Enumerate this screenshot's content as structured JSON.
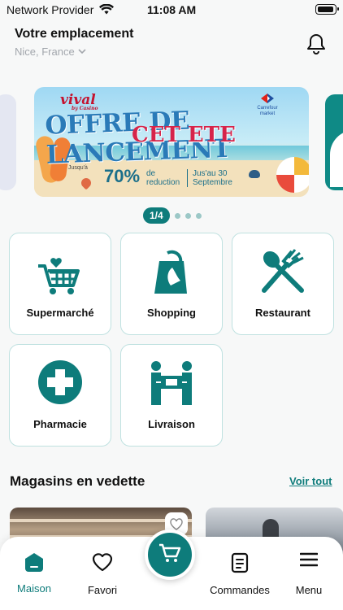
{
  "status_bar": {
    "carrier": "Network Provider",
    "time": "11:08 AM"
  },
  "header": {
    "title": "Votre emplacement",
    "location": "Nice, France"
  },
  "banner": {
    "brand_left": "vival",
    "brand_left_sub": "by Casino",
    "brand_right": "Carrefour market",
    "headline": "OFFRE DE LANCEMENT",
    "subheadline": "CET ETE",
    "promo_prefix": "Jusqu'à",
    "promo_value": "70%",
    "promo_word": "de reduction",
    "promo_date": "Jus'au 30 Septembre"
  },
  "pager": {
    "label": "1/4",
    "total": 4,
    "current": 1
  },
  "categories": [
    {
      "label": "Supermarché",
      "icon": "shopping-cart-heart-icon"
    },
    {
      "label": "Shopping",
      "icon": "shopping-bag-icon"
    },
    {
      "label": "Restaurant",
      "icon": "fork-spoon-icon"
    },
    {
      "label": "Pharmacie",
      "icon": "pharmacy-cross-icon"
    },
    {
      "label": "Livraison",
      "icon": "delivery-handover-icon"
    }
  ],
  "featured": {
    "title": "Magasins en vedette",
    "see_all": "Voir tout"
  },
  "tabbar": {
    "home": "Maison",
    "favorites": "Favori",
    "orders": "Commandes",
    "menu": "Menu"
  },
  "colors": {
    "accent": "#0e7c7b",
    "border": "#bfe1e0",
    "muted": "#a3a7ad"
  }
}
